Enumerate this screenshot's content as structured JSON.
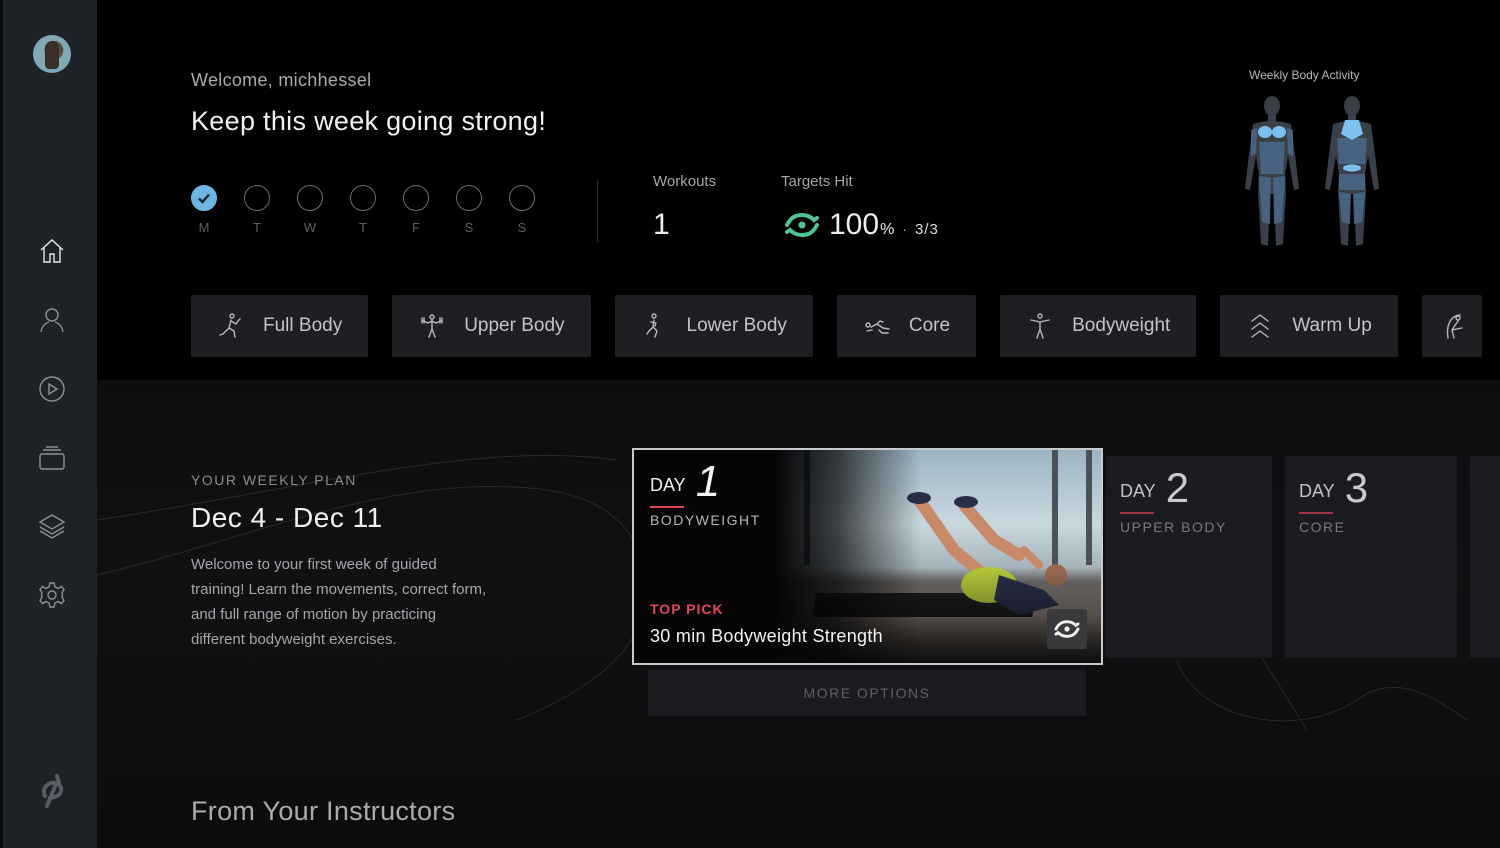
{
  "sidebar": {
    "avatar_alt": "User avatar",
    "items": [
      {
        "name": "home",
        "icon": "home-icon",
        "active": true
      },
      {
        "name": "profile",
        "icon": "person-icon",
        "active": false
      },
      {
        "name": "classes",
        "icon": "play-icon",
        "active": false
      },
      {
        "name": "collections",
        "icon": "stack-icon",
        "active": false
      },
      {
        "name": "programs",
        "icon": "layers-icon",
        "active": false
      },
      {
        "name": "settings",
        "icon": "gear-icon",
        "active": false
      }
    ],
    "logo": "peloton-logo"
  },
  "header": {
    "welcome": "Welcome, michhessel",
    "headline": "Keep this week going strong!"
  },
  "week": {
    "days": [
      {
        "label": "M",
        "done": true
      },
      {
        "label": "T",
        "done": false
      },
      {
        "label": "W",
        "done": false
      },
      {
        "label": "T",
        "done": false
      },
      {
        "label": "F",
        "done": false
      },
      {
        "label": "S",
        "done": false
      },
      {
        "label": "S",
        "done": false
      }
    ]
  },
  "stats": {
    "workouts_label": "Workouts",
    "workouts_value": "1",
    "targets_label": "Targets Hit",
    "targets_pct": "100",
    "targets_pct_sign": "%",
    "targets_dot": "·",
    "targets_fraction": "3/3",
    "accent": "#4fc3a1"
  },
  "body_activity": {
    "title": "Weekly Body Activity",
    "highlight_color": "#6fb5e6"
  },
  "categories": [
    {
      "label": "Full Body",
      "icon": "full-body-icon"
    },
    {
      "label": "Upper Body",
      "icon": "upper-body-icon"
    },
    {
      "label": "Lower Body",
      "icon": "lower-body-icon"
    },
    {
      "label": "Core",
      "icon": "core-icon"
    },
    {
      "label": "Bodyweight",
      "icon": "bodyweight-icon"
    },
    {
      "label": "Warm Up",
      "icon": "warm-up-icon"
    }
  ],
  "plan": {
    "eyebrow": "YOUR WEEKLY PLAN",
    "title": "Dec 4 - Dec 11",
    "description": "Welcome to your first week of guided training! Learn the movements, correct form, and full range of motion by practicing different bodyweight exercises.",
    "featured": {
      "day_word": "DAY",
      "day_num": "1",
      "category": "BODYWEIGHT",
      "top_pick": "TOP PICK",
      "title": "30 min Bodyweight Strength"
    },
    "more_options": "MORE OPTIONS",
    "cards": [
      {
        "day_word": "DAY",
        "day_num": "2",
        "category": "UPPER BODY"
      },
      {
        "day_word": "DAY",
        "day_num": "3",
        "category": "CORE"
      }
    ],
    "accent": "#e14556"
  },
  "instructors": {
    "title": "From Your Instructors"
  }
}
